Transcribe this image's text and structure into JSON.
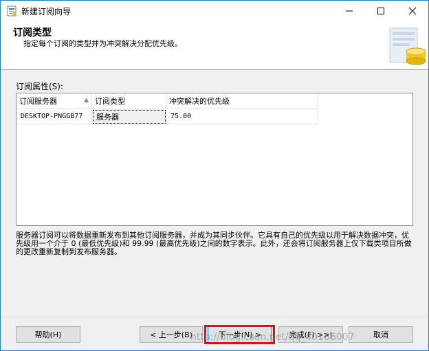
{
  "window": {
    "title": "新建订阅向导"
  },
  "header": {
    "title": "订阅类型",
    "subtitle": "指定每个订阅的类型并为冲突解决分配优先级。"
  },
  "properties": {
    "label": "订阅属性(S):",
    "columns": [
      "订阅服务器",
      "订阅类型",
      "冲突解决的优先级"
    ],
    "rows": [
      {
        "subscriber": "DESKTOP-PNGGB77",
        "type": "服务器",
        "priority": "75.00"
      }
    ]
  },
  "description": "服务器订阅可以将数据重新发布到其他订阅服务器，并成为其同步伙伴。它具有自己的优先级以用于解决数据冲突，优先级用一个介于 0 (最低优先级)和 99.99 (最高优先级)之间的数字表示。此外，还会将订阅服务器上仅下载类项目所做的更改重新复制到发布服务器。",
  "buttons": {
    "help": "帮助(H)",
    "back": "< 上一步(B)",
    "next": "下一步(N) >",
    "finish": "完成(F) >>|",
    "cancel": "取消"
  },
  "watermark": "http://blog.csdn.net/qq_40186007",
  "colors": {
    "highlight_border": "#d21414",
    "window_border": "#1883d7"
  }
}
